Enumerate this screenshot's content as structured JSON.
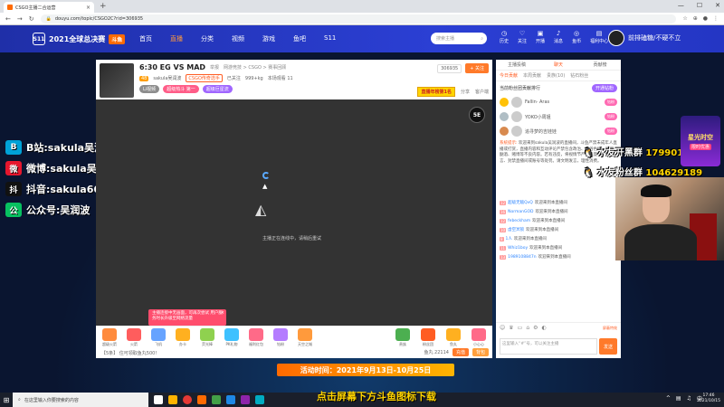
{
  "browser": {
    "tab_title": "CSGO主播二合运营",
    "url": "douyu.com/topic/CSGO2C?rid=306935"
  },
  "site": {
    "logo_text": "斗鱼",
    "logo_badge": "2021全球总决赛",
    "nav": [
      "首页",
      "直播",
      "分类",
      "视频",
      "游戏",
      "鱼吧",
      "S11"
    ],
    "search_placeholder": "搜索主播",
    "header_icons": [
      "历史",
      "关注",
      "开播",
      "消息",
      "鱼币",
      "福利中心"
    ],
    "user_name": "前排磕糖/不硬不立"
  },
  "streamer": {
    "title": "6:30 EG VS MAD",
    "report": "举报",
    "category": "网游竞技 > CSGO > 赛事回顾",
    "name": "sakula吴润波",
    "level": "48",
    "badge": "CSGO传奇选手",
    "followers": "已关注",
    "heat": "999+kg",
    "rank": "本场观看 11",
    "tags": [
      "Li视频",
      "超级热斗 第一",
      "超级巨星流"
    ],
    "room_id": "306935",
    "follow_label": "+ 关注",
    "rank_badge": "直播年榜第1名",
    "share": "分享",
    "client": "客户端"
  },
  "player": {
    "loading_text": "主播正在连线中，请稍后重试",
    "corner_logo": "5E",
    "promo_text": "主播连接中无画面，可再次尝试 用户服务时长升级至网络流量",
    "promo_close": "×"
  },
  "gifts": [
    {
      "label": "超级火箭",
      "color": "#ff8b3d"
    },
    {
      "label": "火箭",
      "color": "#ff5d5d"
    },
    {
      "label": "飞机",
      "color": "#66a3ff"
    },
    {
      "label": "办卡",
      "color": "#ffb020"
    },
    {
      "label": "荧光棒",
      "color": "#8fd14f"
    },
    {
      "label": "PK礼物",
      "color": "#3ec1ff"
    },
    {
      "label": "福利红包",
      "color": "#ff6a88"
    },
    {
      "label": "钻粉",
      "color": "#b47cff"
    },
    {
      "label": "天空之城",
      "color": "#ff9a3c"
    }
  ],
  "gift_right": [
    {
      "label": "贵族",
      "color": "#4caf50"
    },
    {
      "label": "粉丝团",
      "color": "#ff5d23"
    },
    {
      "label": "鱼丸",
      "color": "#ffb020"
    },
    {
      "label": "小心心",
      "color": "#ff6a88"
    }
  ],
  "gift_bar": {
    "fish_ball": "【5条】 住可领取鱼丸500!",
    "balance": "鱼丸 22114",
    "charge": "充值",
    "bag": "背包"
  },
  "chat": {
    "tabs": [
      "主播投稿",
      "聊天",
      "贡献榜"
    ],
    "sub_tabs": [
      "今日贡献",
      "本周贡献",
      "贵族(10)",
      "钻石粉丝"
    ],
    "rank_title": "当前粉丝团贡献排行",
    "rank_button": "开通钻粉",
    "rank_rows": [
      {
        "name": "Fallin· Aras",
        "badge": "钻粉"
      },
      {
        "name": "YOKO小周姐",
        "badge": "钻粉"
      },
      {
        "name": "追寻梦的吉娃娃",
        "badge": "钻粉"
      }
    ],
    "system_tag": "系统提示:",
    "system_text": "欢迎来到sakula吴润波的直播间，斗鱼严禁未成年人直播或打赏，直播内容和互动评论严禁包含政治、低俗色情、吸烟酗酒、赌博等不良内容。若有违反，将视情节严重程度给予禁言、封禁直播间或账号等处罚。请文明发言，理性消费。",
    "messages": [
      {
        "level": "12",
        "user": "超级无敌QvQ",
        "text": "欢迎来到本直播间"
      },
      {
        "level": "16",
        "user": "NormanGOD",
        "text": "欢迎来到本直播间"
      },
      {
        "level": "12",
        "user": "febeckham",
        "text": "欢迎来到本直播间"
      },
      {
        "level": "10",
        "user": "虚空冥锁",
        "text": "欢迎来到本直播间"
      },
      {
        "level": "8",
        "user": "1人",
        "text": "欢迎来到本直播间"
      },
      {
        "level": "11",
        "user": "Whiz1boy",
        "text": "欢迎来到本直播间"
      },
      {
        "level": "13",
        "user": "1989108847n",
        "text": "欢迎来到本直播间"
      }
    ],
    "input_placeholder": "这里输入“#”号，可以关注主播",
    "send": "发送",
    "ratio": "屏蔽特效"
  },
  "overlays": {
    "social": [
      {
        "icon": "B",
        "label": "B站:sakula吴润波",
        "color": "#00a1d6"
      },
      {
        "icon": "微",
        "label": "微博:sakula吴润波",
        "color": "#e6162d"
      },
      {
        "icon": "抖",
        "label": "抖音:sakula6688",
        "color": "#111111"
      },
      {
        "icon": "公",
        "label": "公众号:吴润波",
        "color": "#07c160"
      }
    ],
    "qq1_label": "水友开黑群",
    "qq1_num": "179901911",
    "qq2_label": "水友粉丝群",
    "qq2_num": "104629189",
    "side_promo_title": "星光时空",
    "side_promo_tag": "限时优惠",
    "activity": "活动时间：2021年9月13日-10月25日",
    "subtitle": "点击屏幕下方斗鱼图标下载"
  },
  "taskbar": {
    "search": "在这里输入你要搜索的内容",
    "time": "17:46",
    "date": "2021/10/15"
  }
}
